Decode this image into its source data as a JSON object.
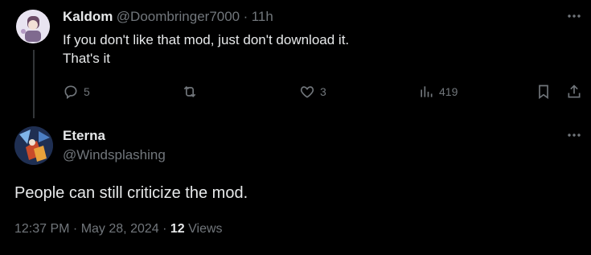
{
  "tweet1": {
    "display_name": "Kaldom",
    "handle": "@Doombringer7000",
    "separator": "·",
    "time": "11h",
    "line1": "If you don't like that mod, just don't download it.",
    "line2": "That's it",
    "replies": "5",
    "likes": "3",
    "views": "419"
  },
  "tweet2": {
    "display_name": "Eterna",
    "handle": "@Windsplashing",
    "text": "People can still criticize the mod.",
    "timestamp": "12:37 PM · May 28, 2024 · ",
    "views_count": "12",
    "views_label": "Views"
  },
  "colors": {
    "background": "#000000",
    "text_primary": "#e7e9ea",
    "text_muted": "#71767b",
    "thread_line": "#333639"
  }
}
